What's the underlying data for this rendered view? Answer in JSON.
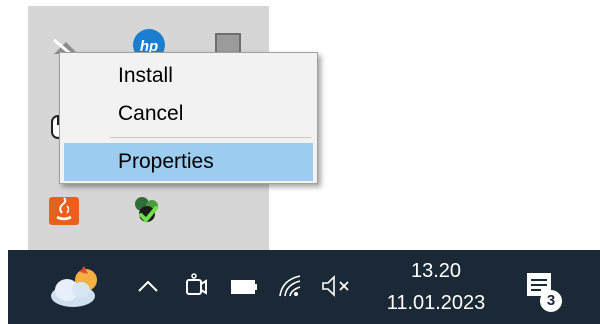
{
  "context_menu": {
    "items": [
      {
        "label": "Install",
        "highlighted": false
      },
      {
        "label": "Cancel",
        "highlighted": false
      },
      {
        "label": "Properties",
        "highlighted": true
      }
    ]
  },
  "tray_flyout": {
    "icons": [
      "network-disabled-icon",
      "hp-icon",
      "app-window-icon",
      "mouse-icon",
      "java-update-icon",
      "security-shield-icon"
    ]
  },
  "taskbar": {
    "weather_icon": "weather-cloudy-sun-icon",
    "overflow_icon": "chevron-up-icon",
    "icons": [
      "meet-now-icon",
      "battery-icon",
      "wifi-icon",
      "volume-muted-icon"
    ],
    "clock": {
      "time": "13.20",
      "date": "11.01.2023"
    },
    "notifications": {
      "icon": "notification-center-icon",
      "count": "3"
    }
  },
  "colors": {
    "taskbar_bg": "#1b2936",
    "menu_bg": "#f2f2f2",
    "menu_highlight": "#9cccf0",
    "flyout_bg": "#d6d6d6"
  }
}
